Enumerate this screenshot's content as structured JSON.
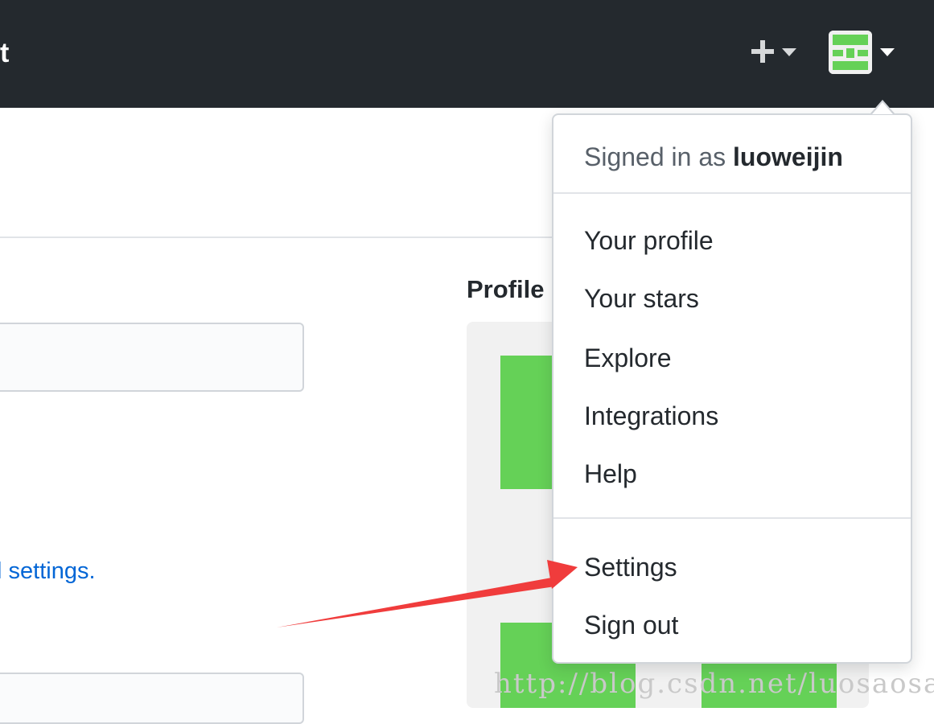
{
  "header": {
    "left_text": "t",
    "plus_caret_icon": "caret-down-icon",
    "avatar_icon": "identicon-avatar",
    "colors": {
      "background": "#24292e",
      "icon": "#d6d8da"
    }
  },
  "page": {
    "settings_link_fragment": "settings",
    "settings_link_period": ".",
    "settings_link_leading": "l",
    "profile_heading": "Profile",
    "accent_green": "#65d157",
    "link_color": "#0366d6"
  },
  "dropdown": {
    "signed_in_prefix": "Signed in as",
    "username": "luoweijin",
    "items": [
      {
        "label": "Your profile"
      },
      {
        "label": "Your stars"
      },
      {
        "label": "Explore"
      },
      {
        "label": "Integrations"
      },
      {
        "label": "Help"
      }
    ],
    "footer_items": [
      {
        "label": "Settings"
      },
      {
        "label": "Sign out"
      }
    ]
  },
  "annotation": {
    "arrow_color": "#f03c3c"
  },
  "watermark": "http://blog.csdn.net/luosaosa"
}
